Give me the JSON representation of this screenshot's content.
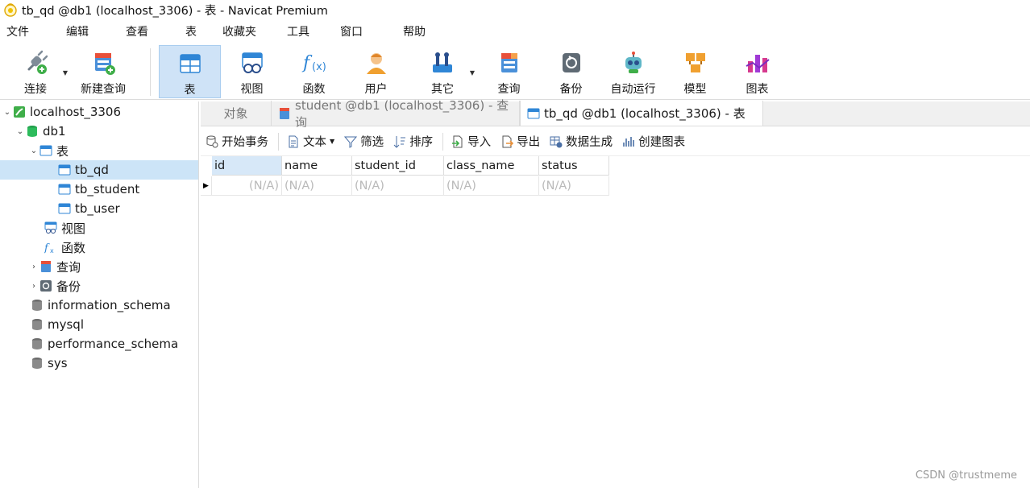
{
  "window": {
    "title": "tb_qd @db1 (localhost_3306) - 表 - Navicat Premium"
  },
  "menu": [
    "文件",
    "编辑",
    "查看",
    "表",
    "收藏夹",
    "工具",
    "窗口",
    "帮助"
  ],
  "toolbar": {
    "connect": "连接",
    "new_query": "新建查询",
    "table": "表",
    "view": "视图",
    "function": "函数",
    "user": "用户",
    "other": "其它",
    "query": "查询",
    "backup": "备份",
    "automation": "自动运行",
    "model": "模型",
    "chart": "图表"
  },
  "sidebar": {
    "connection": "localhost_3306",
    "database": "db1",
    "tables_group": "表",
    "tables": [
      "tb_qd",
      "tb_student",
      "tb_user"
    ],
    "views_group": "视图",
    "functions_group": "函数",
    "queries_group": "查询",
    "backups_group": "备份",
    "other_databases": [
      "information_schema",
      "mysql",
      "performance_schema",
      "sys"
    ]
  },
  "tabs": {
    "objects": "对象",
    "query_tab": "student @db1 (localhost_3306) - 查询",
    "table_tab": "tb_qd @db1 (localhost_3306) - 表"
  },
  "object_toolbar": {
    "begin_transaction": "开始事务",
    "text": "文本",
    "filter": "筛选",
    "sort": "排序",
    "import": "导入",
    "export": "导出",
    "data_generation": "数据生成",
    "create_chart": "创建图表"
  },
  "grid": {
    "columns": [
      "id",
      "name",
      "student_id",
      "class_name",
      "status"
    ],
    "row": [
      "(N/A)",
      "(N/A)",
      "(N/A)",
      "(N/A)",
      "(N/A)"
    ]
  },
  "watermark": "CSDN @trustmeme"
}
